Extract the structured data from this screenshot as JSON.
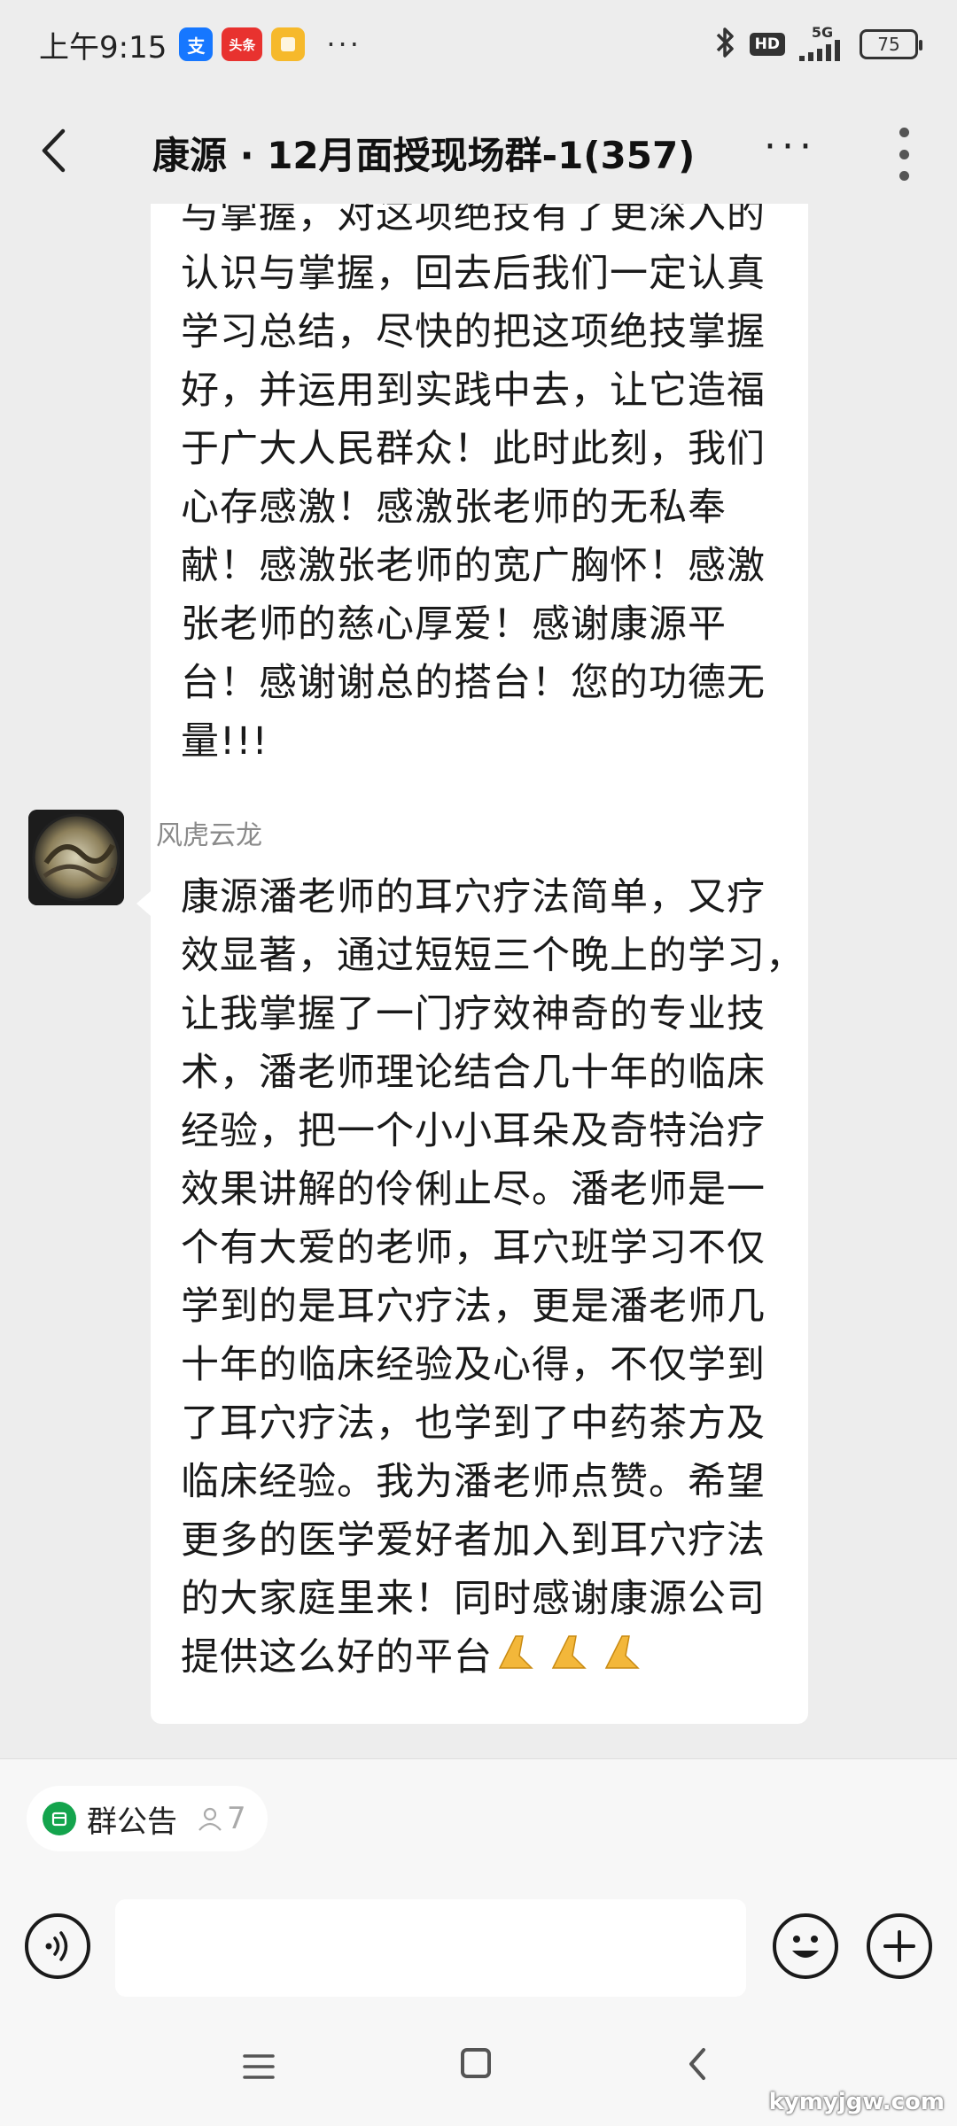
{
  "status_bar": {
    "time": "上午9:15",
    "apps": [
      "支",
      "头条",
      "便"
    ],
    "more": "···",
    "hd": "HD",
    "network": "5G",
    "battery": "75"
  },
  "header": {
    "title": "康源 · 12月面授现场群-1(357)",
    "more_label": "···"
  },
  "messages": [
    {
      "lines": [
        "与掌握，对这项绝技有了更深入的",
        "认识与掌握，回去后我们一定认真",
        "学习总结，尽快的把这项绝技掌握",
        "好，并运用到实践中去，让它造福",
        "于广大人民群众！此时此刻，我们",
        "心存感激！感激张老师的无私奉",
        "献！感激张老师的宽广胸怀！感激",
        "张老师的慈心厚爱！感谢康源平",
        "台！感谢谢总的搭台！您的功德无",
        "量!!!"
      ]
    },
    {
      "sender": "风虎云龙",
      "lines": [
        "康源潘老师的耳穴疗法简单，又疗",
        "效显著，通过短短三个晚上的学习，",
        "让我掌握了一门疗效神奇的专业技",
        "术，潘老师理论结合几十年的临床",
        "经验，把一个小小耳朵及奇特治疗",
        "效果讲解的伶俐止尽。潘老师是一",
        "个有大爱的老师，耳穴班学习不仅",
        "学到的是耳穴疗法，更是潘老师几",
        "十年的临床经验及心得，不仅学到",
        "了耳穴疗法，也学到了中药茶方及",
        "临床经验。我为潘老师点赞。希望",
        "更多的医学爱好者加入到耳穴疗法",
        "的大家庭里来！同时感谢康源公司",
        "提供这么好的平台"
      ],
      "emoji": "pray-hands x3"
    }
  ],
  "announcement": {
    "label": "群公告",
    "count": "7"
  },
  "input": {
    "placeholder": ""
  },
  "watermark": "kymyjgw.com",
  "colors": {
    "background": "#ededed",
    "bubble": "#ffffff",
    "announce_green": "#14a44d"
  }
}
